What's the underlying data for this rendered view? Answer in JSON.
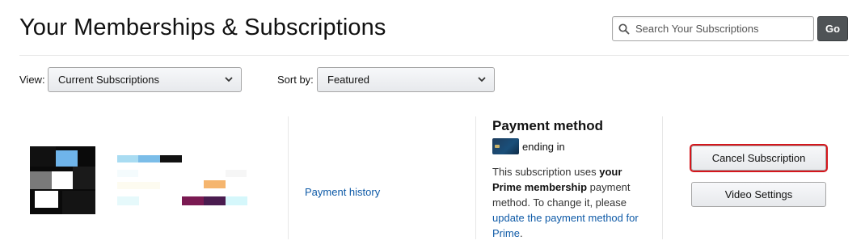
{
  "page": {
    "title": "Your Memberships & Subscriptions"
  },
  "search": {
    "placeholder": "Search Your Subscriptions",
    "button_label": "Go"
  },
  "filters": {
    "view_label": "View:",
    "view_selected": "Current Subscriptions",
    "sort_label": "Sort by:",
    "sort_selected": "Featured"
  },
  "subscription": {
    "payment_history_label": "Payment history",
    "payment_method": {
      "heading": "Payment method",
      "ending_text": "ending in",
      "desc_1": "This subscription uses ",
      "desc_bold": "your Prime membership",
      "desc_2": " payment method. To change it, please ",
      "link_label": "update the payment method for Prime",
      "desc_end": "."
    },
    "actions": {
      "cancel_label": "Cancel Subscription",
      "video_settings_label": "Video Settings"
    }
  },
  "colors": {
    "link": "#0e5aa7",
    "highlight_outline": "#d5161c",
    "go_button": "#4f5356"
  }
}
